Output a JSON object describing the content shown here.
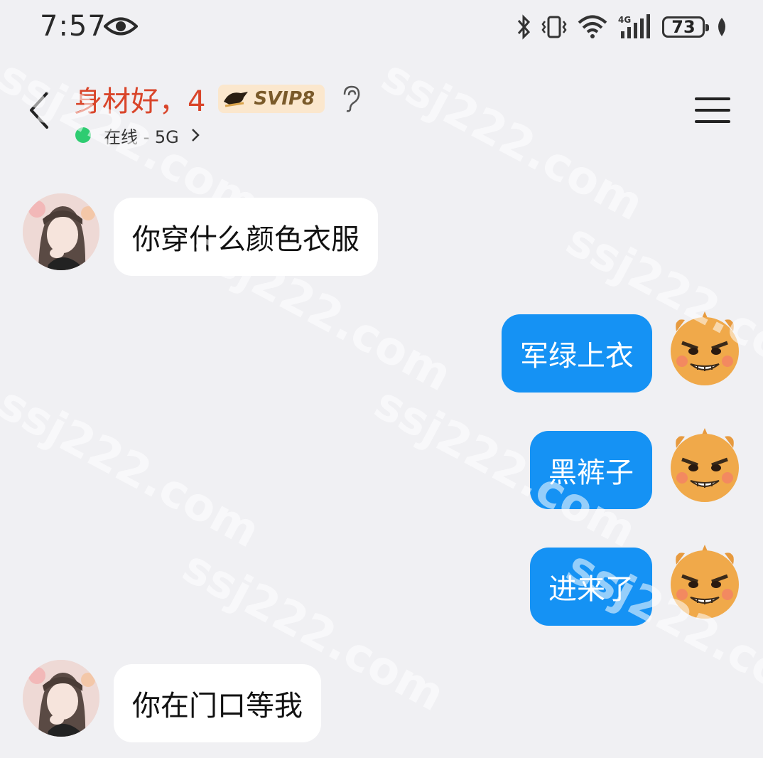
{
  "status_bar": {
    "time": "7:57",
    "battery": "73",
    "icons": [
      "eye-icon",
      "bluetooth-icon",
      "vibrate-icon",
      "wifi-icon",
      "signal-4g-icon",
      "battery-icon",
      "leaf-icon"
    ],
    "network": "4G"
  },
  "header": {
    "title": "身材好，4",
    "vip_label": "SVIP8",
    "status_text": "在线 - 5G",
    "online_color": "#2ecc71"
  },
  "messages": [
    {
      "side": "incoming",
      "text": "你穿什么颜色衣服",
      "avatar": "girl"
    },
    {
      "side": "outgoing",
      "text": "军绿上衣",
      "avatar": "bear"
    },
    {
      "side": "outgoing",
      "text": "黑裤子",
      "avatar": "bear"
    },
    {
      "side": "outgoing",
      "text": "进来了",
      "avatar": "bear"
    },
    {
      "side": "incoming",
      "text": "你在门口等我",
      "avatar": "girl"
    }
  ],
  "watermark": "ssj222.com",
  "colors": {
    "background": "#f0f0f3",
    "outgoing_bubble": "#1592f4",
    "incoming_bubble": "#ffffff",
    "title": "#d9452a",
    "vip_badge": "#fbe7cd"
  }
}
